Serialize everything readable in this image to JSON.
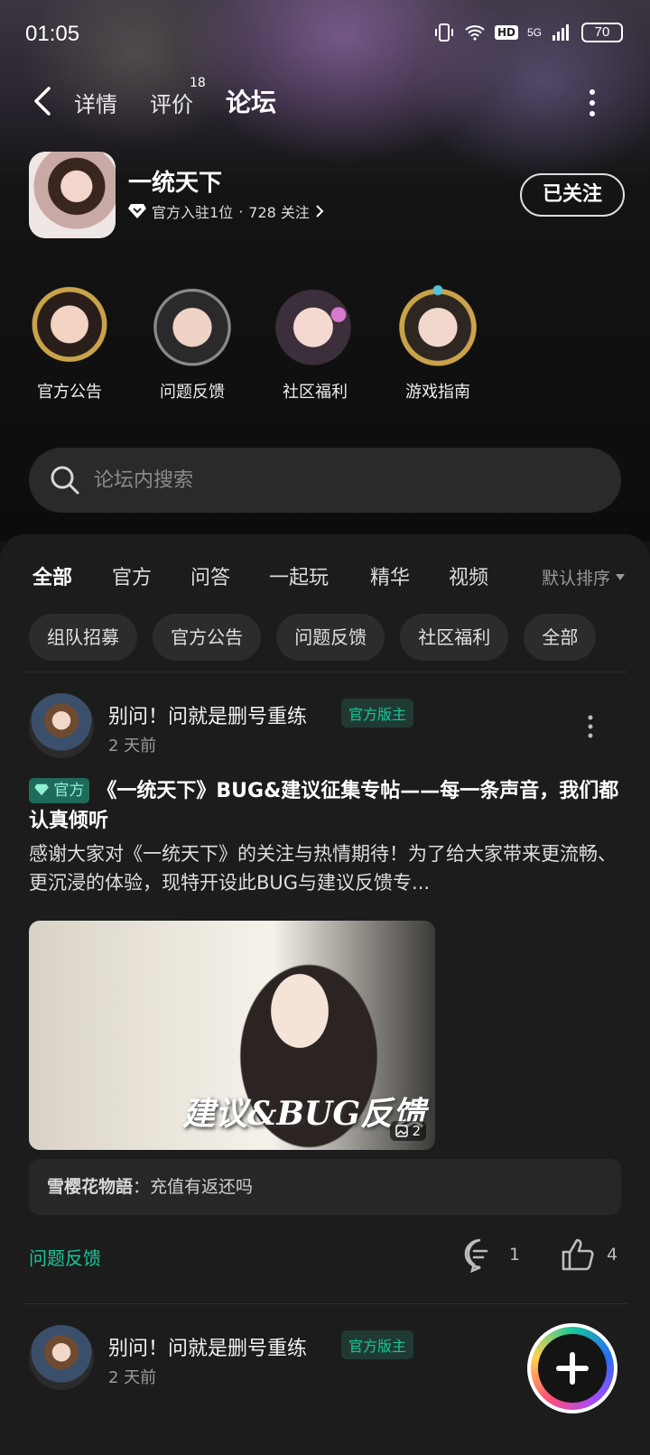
{
  "status_bar": {
    "time": "01:05",
    "battery": "70",
    "network": "5G",
    "hd": "HD"
  },
  "nav": {
    "tabs": [
      {
        "label": "详情"
      },
      {
        "label": "评价",
        "badge": "18"
      },
      {
        "label": "论坛"
      }
    ],
    "active_tab": "论坛"
  },
  "game": {
    "name": "一统天下",
    "meta_official": "官方入驻1位",
    "meta_sep": "·",
    "meta_followers": "728 关注",
    "follow_label": "已关注"
  },
  "shortcuts": [
    {
      "label": "官方公告",
      "icon": "official-announcement-portrait"
    },
    {
      "label": "问题反馈",
      "icon": "feedback-portrait"
    },
    {
      "label": "社区福利",
      "icon": "community-welfare-portrait"
    },
    {
      "label": "游戏指南",
      "icon": "game-guide-portrait"
    }
  ],
  "search": {
    "placeholder": "论坛内搜索"
  },
  "tabs": {
    "items": [
      "全部",
      "官方",
      "问答",
      "一起玩",
      "精华",
      "视频"
    ],
    "active": "全部",
    "sort_label": "默认排序"
  },
  "chips": [
    "组队招募",
    "官方公告",
    "问题反馈",
    "社区福利",
    "全部"
  ],
  "posts": [
    {
      "author": "别问！问就是删号重练",
      "role": "官方版主",
      "time": "2 天前",
      "official_tag": "官方",
      "title": "《一统天下》BUG&建议征集专帖——每一条声音，我们都认真倾听",
      "body": "感谢大家对《一统天下》的关注与热情期待！为了给大家带来更流畅、更沉浸的体验，现特开设此BUG与建议反馈专...",
      "image_text": "建议&BUG反馈",
      "image_count": "2",
      "comment_name": "雪樱花物語",
      "comment_sep": "：",
      "comment_text": "充值有返还吗",
      "tag": "问题反馈",
      "comments": "1",
      "likes": "4"
    },
    {
      "author": "别问！问就是删号重练",
      "role": "官方版主",
      "time": "2 天前"
    }
  ],
  "colors": {
    "accent": "#16c79a",
    "panel": "#1c1c1c",
    "background": "#141414"
  }
}
